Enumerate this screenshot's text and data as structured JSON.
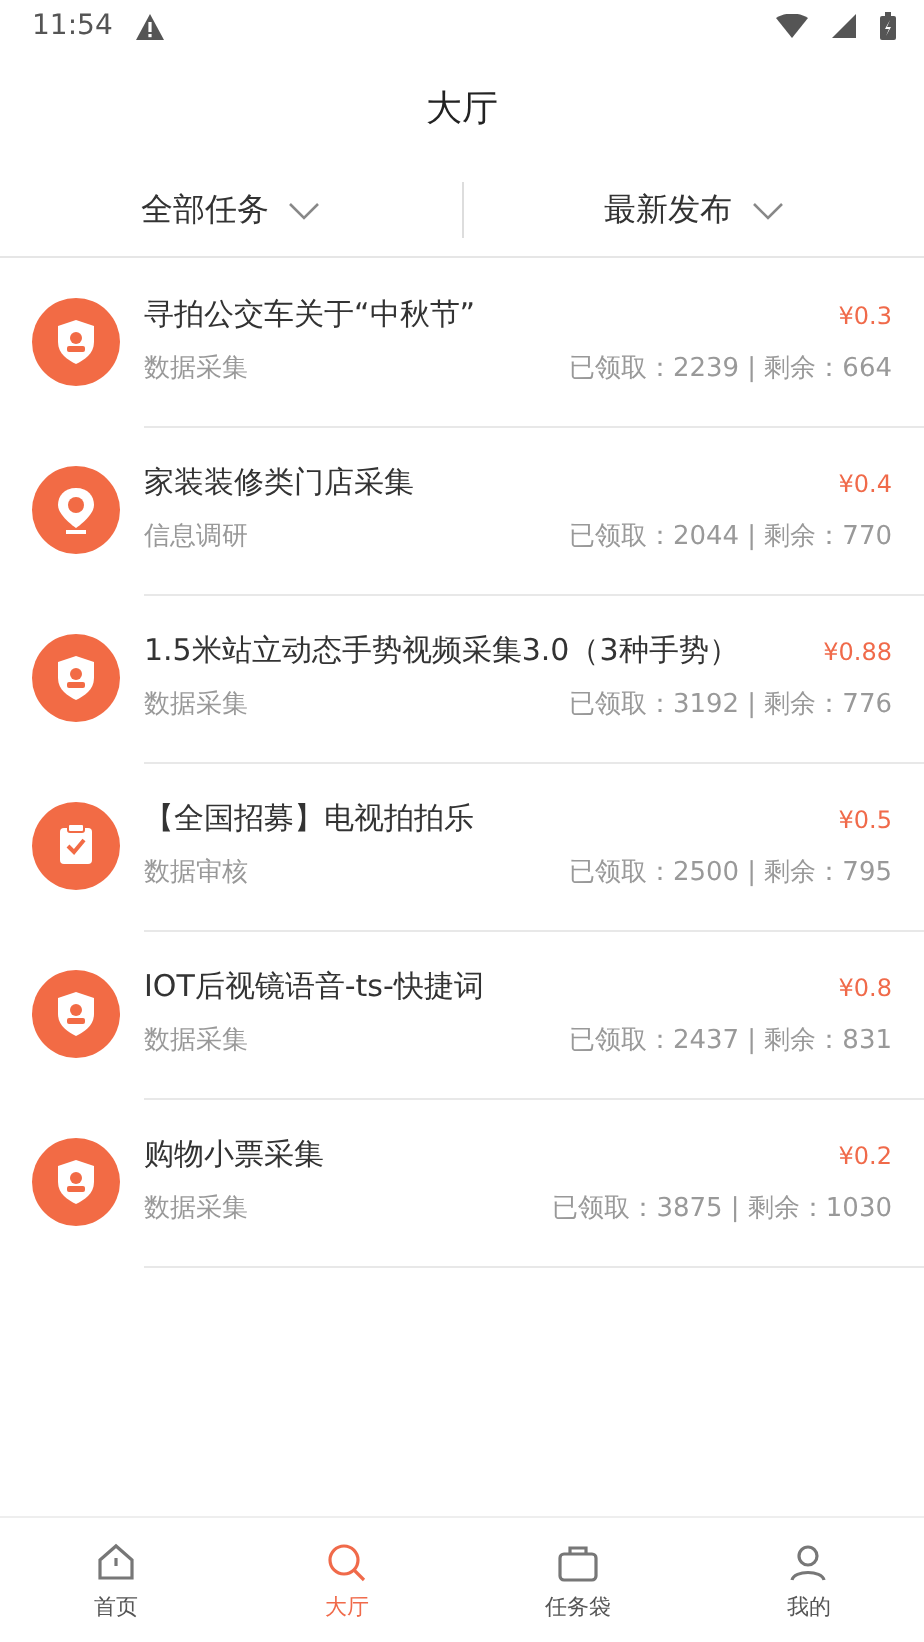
{
  "status_bar": {
    "time": "11:54"
  },
  "header": {
    "title": "大厅"
  },
  "filters": [
    {
      "label": "全部任务"
    },
    {
      "label": "最新发布"
    }
  ],
  "tasks": [
    {
      "kind": "shield",
      "title": "寻拍公交车关于“中秋节”",
      "category": "数据采集",
      "price": "¥0.3",
      "stats": "已领取：2239 | 剩余：664"
    },
    {
      "kind": "pin",
      "title": "家装装修类门店采集",
      "category": "信息调研",
      "price": "¥0.4",
      "stats": "已领取：2044 | 剩余：770"
    },
    {
      "kind": "shield",
      "title": "1.5米站立动态手势视频采集3.0（3种手势）",
      "category": "数据采集",
      "price": "¥0.88",
      "stats": "已领取：3192 | 剩余：776"
    },
    {
      "kind": "clipboard",
      "title": "【全国招募】电视拍拍乐",
      "category": "数据审核",
      "price": "¥0.5",
      "stats": "已领取：2500 | 剩余：795"
    },
    {
      "kind": "shield",
      "title": "IOT后视镜语音-ts-快捷词",
      "category": "数据采集",
      "price": "¥0.8",
      "stats": "已领取：2437 | 剩余：831"
    },
    {
      "kind": "shield",
      "title": "购物小票采集",
      "category": "数据采集",
      "price": "¥0.2",
      "stats": "已领取：3875 | 剩余：1030"
    }
  ],
  "nav": [
    {
      "kind": "home",
      "label": "首页",
      "selected": false
    },
    {
      "kind": "search",
      "label": "大厅",
      "selected": true
    },
    {
      "kind": "bag",
      "label": "任务袋",
      "selected": false
    },
    {
      "kind": "user",
      "label": "我的",
      "selected": false
    }
  ]
}
